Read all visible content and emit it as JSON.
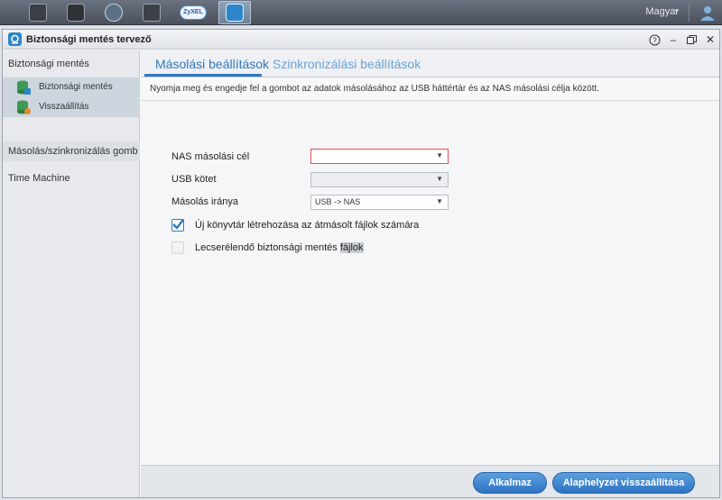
{
  "taskbar": {
    "apps": [
      {
        "name": "file-browser-app-icon",
        "color": "#3a3f47"
      },
      {
        "name": "photo-app-icon",
        "color": "#2f3338"
      },
      {
        "name": "music-app-icon",
        "color": "#5b6f86"
      },
      {
        "name": "video-app-icon",
        "color": "#3c4048"
      },
      {
        "name": "zyxel-cloud-app-icon",
        "color": "#4d8fd1"
      },
      {
        "name": "backup-planner-app-icon",
        "color": "#2d86c9"
      }
    ],
    "language": "Magyar"
  },
  "window": {
    "title": "Biztonsági mentés tervező"
  },
  "sidebar": {
    "section_backup": "Biztonsági mentés",
    "items": [
      {
        "label": "Biztonsági mentés"
      },
      {
        "label": "Visszaállítás"
      }
    ],
    "section_copy": "Másolás/szinkronizálás gomb",
    "section_tm": "Time Machine"
  },
  "tabs": {
    "copy": "Másolási beállítások",
    "sync": "Szinkronizálási beállítások"
  },
  "description": "Nyomja meg és engedje fel a gombot az adatok másolásához az USB háttértár és az NAS másolási célja között.",
  "form": {
    "nas_target_label": "NAS másolási cél",
    "nas_target_value": "",
    "usb_volume_label": "USB kötet",
    "usb_volume_value": "",
    "direction_label": "Másolás iránya",
    "direction_value": "USB -> NAS",
    "new_folder_label": "Új könyvtár létrehozása az átmásolt fájlok számára",
    "replace_label_prefix": "Lecserélendő biztonsági mentés ",
    "replace_label_highlight": "fájlok"
  },
  "buttons": {
    "apply": "Alkalmaz",
    "reset": "Alaphelyzet visszaállítása"
  },
  "colors": {
    "accent": "#2f78bd",
    "error": "#e05050"
  }
}
